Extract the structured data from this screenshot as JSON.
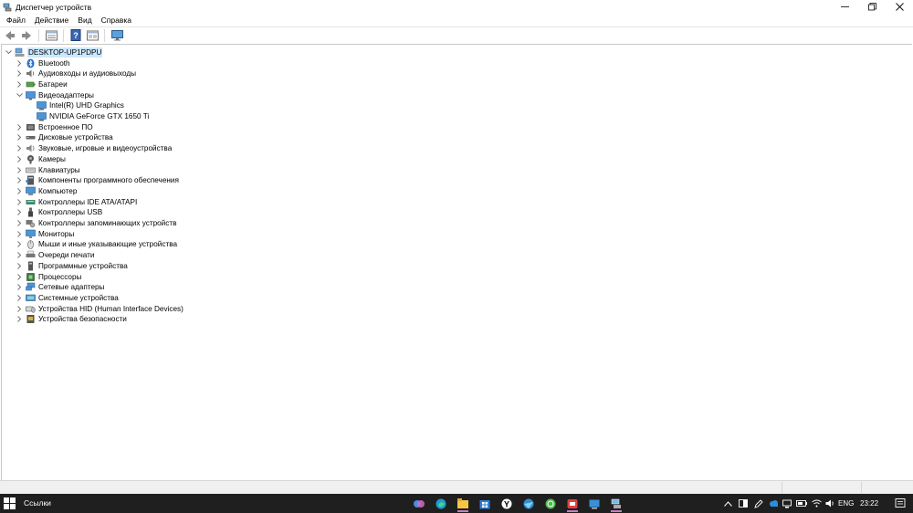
{
  "window": {
    "title": "Диспетчер устройств",
    "controls": [
      "minimize",
      "maximize",
      "close"
    ]
  },
  "menu": [
    "Файл",
    "Действие",
    "Вид",
    "Справка"
  ],
  "toolbar": {
    "buttons": [
      "back-icon",
      "forward-icon",
      "properties-icon",
      "help-icon",
      "details-icon",
      "monitor-scan-icon"
    ]
  },
  "tree": {
    "root": "DESKTOP-UP1PDPU",
    "categories": [
      {
        "label": "Bluetooth",
        "icon": "bluetooth-icon",
        "expanded": false
      },
      {
        "label": "Аудиовходы и аудиовыходы",
        "icon": "speaker-icon",
        "expanded": false
      },
      {
        "label": "Батареи",
        "icon": "battery-icon",
        "expanded": false
      },
      {
        "label": "Видеоадаптеры",
        "icon": "display-adapter-icon",
        "expanded": true,
        "children": [
          "Intel(R) UHD Graphics",
          "NVIDIA GeForce GTX 1650 Ti"
        ]
      },
      {
        "label": "Встроенное ПО",
        "icon": "firmware-icon",
        "expanded": false
      },
      {
        "label": "Дисковые устройства",
        "icon": "disk-icon",
        "expanded": false
      },
      {
        "label": "Звуковые, игровые и видеоустройства",
        "icon": "sound-icon",
        "expanded": false
      },
      {
        "label": "Камеры",
        "icon": "camera-icon",
        "expanded": false
      },
      {
        "label": "Клавиатуры",
        "icon": "keyboard-icon",
        "expanded": false
      },
      {
        "label": "Компоненты программного обеспечения",
        "icon": "software-component-icon",
        "expanded": false
      },
      {
        "label": "Компьютер",
        "icon": "computer-icon",
        "expanded": false
      },
      {
        "label": "Контроллеры IDE ATA/ATAPI",
        "icon": "ide-controller-icon",
        "expanded": false
      },
      {
        "label": "Контроллеры USB",
        "icon": "usb-icon",
        "expanded": false
      },
      {
        "label": "Контроллеры запоминающих устройств",
        "icon": "storage-controller-icon",
        "expanded": false
      },
      {
        "label": "Мониторы",
        "icon": "monitor-icon",
        "expanded": false
      },
      {
        "label": "Мыши и иные указывающие устройства",
        "icon": "mouse-icon",
        "expanded": false
      },
      {
        "label": "Очереди печати",
        "icon": "printer-icon",
        "expanded": false
      },
      {
        "label": "Программные устройства",
        "icon": "software-device-icon",
        "expanded": false
      },
      {
        "label": "Процессоры",
        "icon": "processor-icon",
        "expanded": false
      },
      {
        "label": "Сетевые адаптеры",
        "icon": "network-adapter-icon",
        "expanded": false
      },
      {
        "label": "Системные устройства",
        "icon": "system-device-icon",
        "expanded": false
      },
      {
        "label": "Устройства HID (Human Interface Devices)",
        "icon": "hid-icon",
        "expanded": false
      },
      {
        "label": "Устройства безопасности",
        "icon": "security-device-icon",
        "expanded": false
      }
    ]
  },
  "taskbar": {
    "search_label": "Ссылки",
    "apps": [
      "copilot-icon",
      "edge-icon",
      "file-explorer-icon",
      "store-icon",
      "yandex-browser-icon",
      "browser-icon",
      "whatsapp-icon",
      "red-app-icon",
      "blue-app-icon",
      "device-manager-icon"
    ],
    "tray": [
      "chevron-up-icon",
      "tablet-icon",
      "pen-icon",
      "cloud-icon",
      "network-icon",
      "battery-icon",
      "volume-icon"
    ],
    "language": "ENG",
    "time": "23:22"
  },
  "colors": {
    "selection": "#cce8ff",
    "taskbar": "#1f1f1f",
    "accent_underline": "#c77dc7"
  }
}
